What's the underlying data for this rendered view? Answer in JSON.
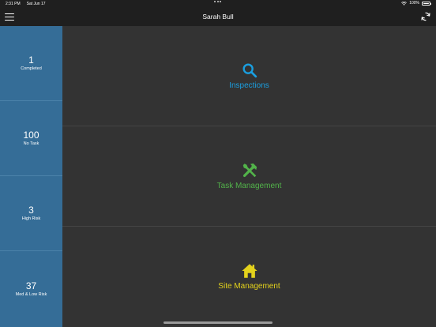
{
  "status_bar": {
    "time": "2:31 PM",
    "date": "Sat Jun 17",
    "battery": "100%"
  },
  "nav": {
    "title": "Sarah Bull"
  },
  "sidebar": {
    "stats": [
      {
        "value": "1",
        "label": "Completed"
      },
      {
        "value": "100",
        "label": "No Task"
      },
      {
        "value": "3",
        "label": "High Risk"
      },
      {
        "value": "37",
        "label": "Med & Low Risk"
      }
    ]
  },
  "tiles": [
    {
      "label": "Inspections",
      "icon": "search-icon",
      "color": "#1a9fe0"
    },
    {
      "label": "Task Management",
      "icon": "tools-icon",
      "color": "#52b34a"
    },
    {
      "label": "Site Management",
      "icon": "home-icon",
      "color": "#e3d21c"
    }
  ],
  "colors": {
    "sidebar": "#356d97",
    "background": "#333333",
    "header": "#1f1f1f"
  }
}
